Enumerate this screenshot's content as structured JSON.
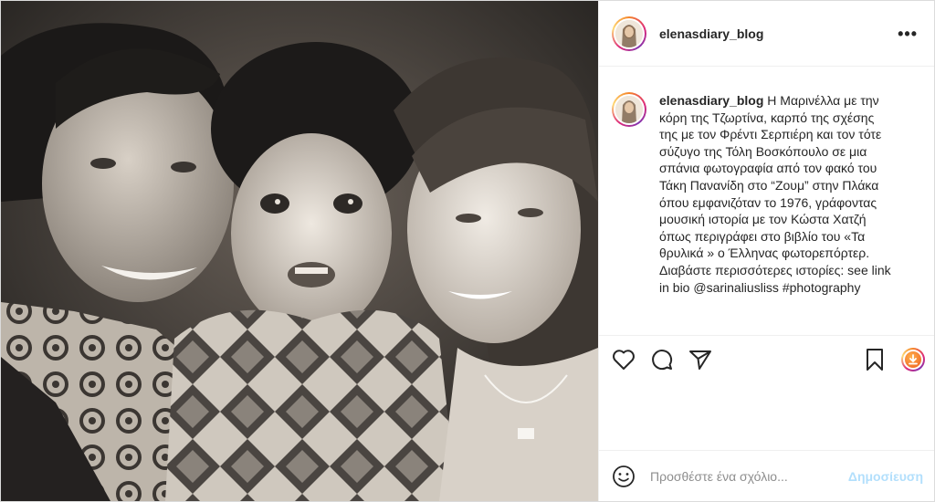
{
  "post": {
    "username": "elenasdiary_blog",
    "more_icon": "more-horizontal-icon",
    "more_glyph": "•••"
  },
  "caption": {
    "username": "elenasdiary_blog",
    "text": "Η Μαρινέλλα με την κόρη της Τζωρτίνα, καρπό της σχέσης της με τον Φρέντι Σερπιέρη και τον τότε σύζυγο της Τόλη Βοσκόπουλο σε μια σπάνια φωτογραφία από τον φακό του Τάκη Πανανίδη στο “Ζουμ” στην Πλάκα όπου εμφανιζόταν το 1976, γράφοντας μουσική ιστορία με τον Κώστα Χατζή όπως περιγράφει στο βιβλίο του «Τα θρυλικά » ο Έλληνας φωτορεπόρτερ. Διαβάστε περισσότερες ιστορίες: see link in bio @sarinaliusliss #photography"
  },
  "actions": {
    "like_icon": "heart-icon",
    "comment_icon": "comment-icon",
    "share_icon": "paper-plane-icon",
    "save_icon": "bookmark-icon",
    "download_icon": "download-circle-icon"
  },
  "comment": {
    "placeholder": "Προσθέστε ένα σχόλιο...",
    "emoji_icon": "smiley-icon",
    "post_label": "Δημοσίευση"
  },
  "colors": {
    "accent": "#0095f6",
    "post_button_disabled": "#b2dffc",
    "border": "#dbdbdb",
    "text": "#262626",
    "muted": "#8e8e8e"
  }
}
